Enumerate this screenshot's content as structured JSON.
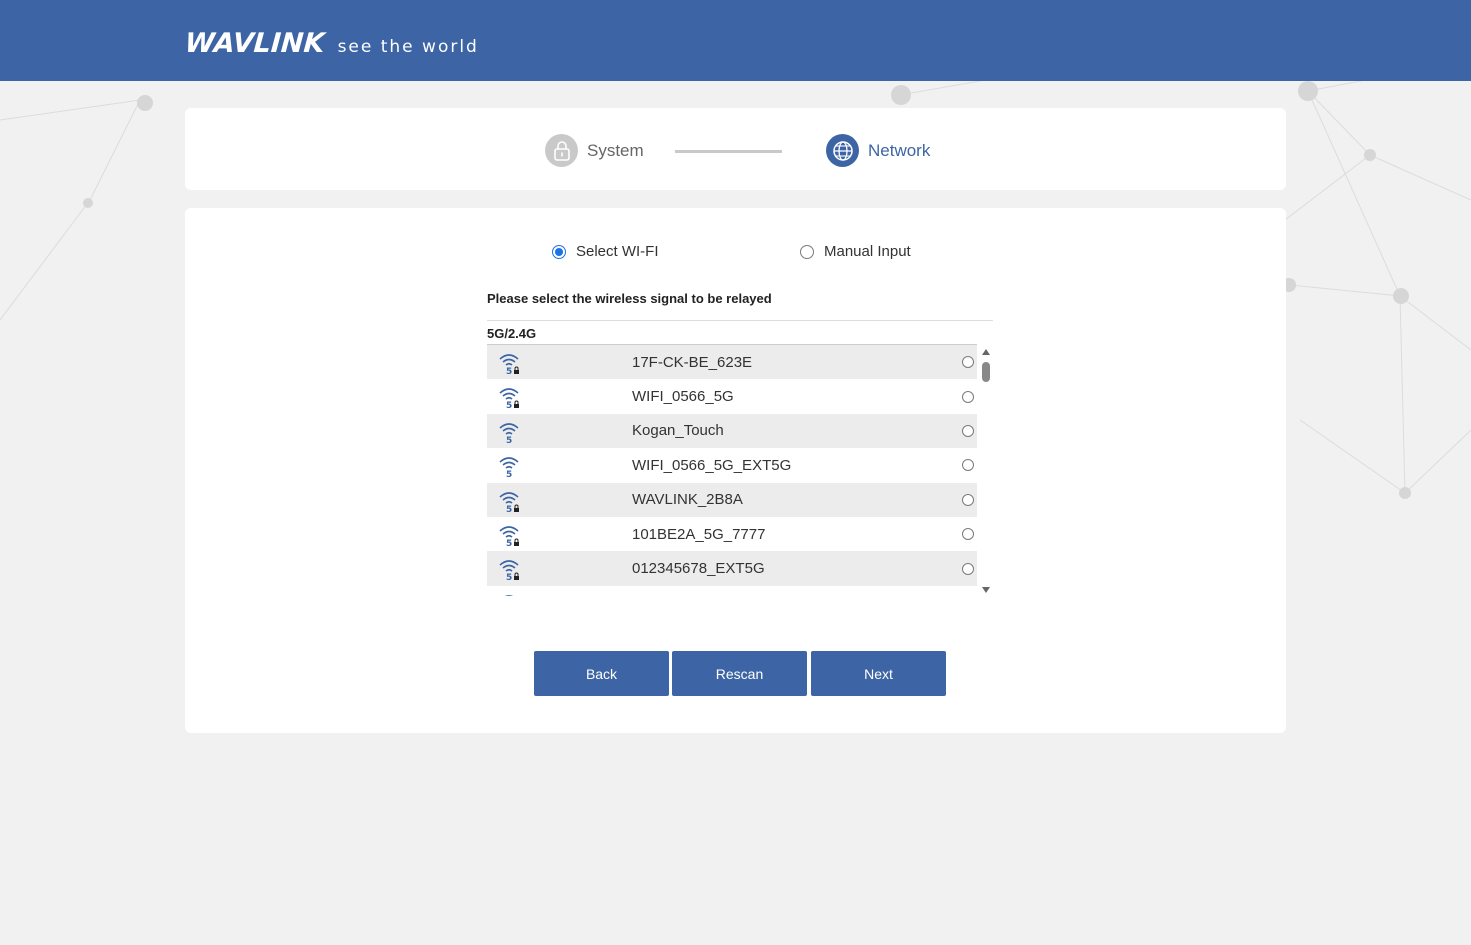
{
  "brand": {
    "name": "WAVLINK",
    "tagline": "see the world"
  },
  "steps": [
    {
      "label": "System",
      "icon": "lock-icon",
      "state": "done"
    },
    {
      "label": "Network",
      "icon": "globe-icon",
      "state": "active"
    }
  ],
  "mode": {
    "options": [
      {
        "label": "Select WI-FI",
        "checked": true
      },
      {
        "label": "Manual Input",
        "checked": false
      }
    ]
  },
  "instruction": "Please select the wireless signal to be relayed",
  "band_label": "5G/2.4G",
  "networks": [
    {
      "ssid": "17F-CK-BE_623E",
      "band": "5",
      "locked": true
    },
    {
      "ssid": "WIFI_0566_5G",
      "band": "5",
      "locked": true
    },
    {
      "ssid": "Kogan_Touch",
      "band": "5",
      "locked": false
    },
    {
      "ssid": "WIFI_0566_5G_EXT5G",
      "band": "5",
      "locked": false
    },
    {
      "ssid": "WAVLINK_2B8A",
      "band": "5",
      "locked": true
    },
    {
      "ssid": "101BE2A_5G_7777",
      "band": "5",
      "locked": true
    },
    {
      "ssid": "012345678_EXT5G",
      "band": "5",
      "locked": true
    }
  ],
  "buttons": {
    "back": "Back",
    "rescan": "Rescan",
    "next": "Next"
  },
  "colors": {
    "primary": "#3d65a5",
    "radio_accent": "#1a73e8"
  }
}
